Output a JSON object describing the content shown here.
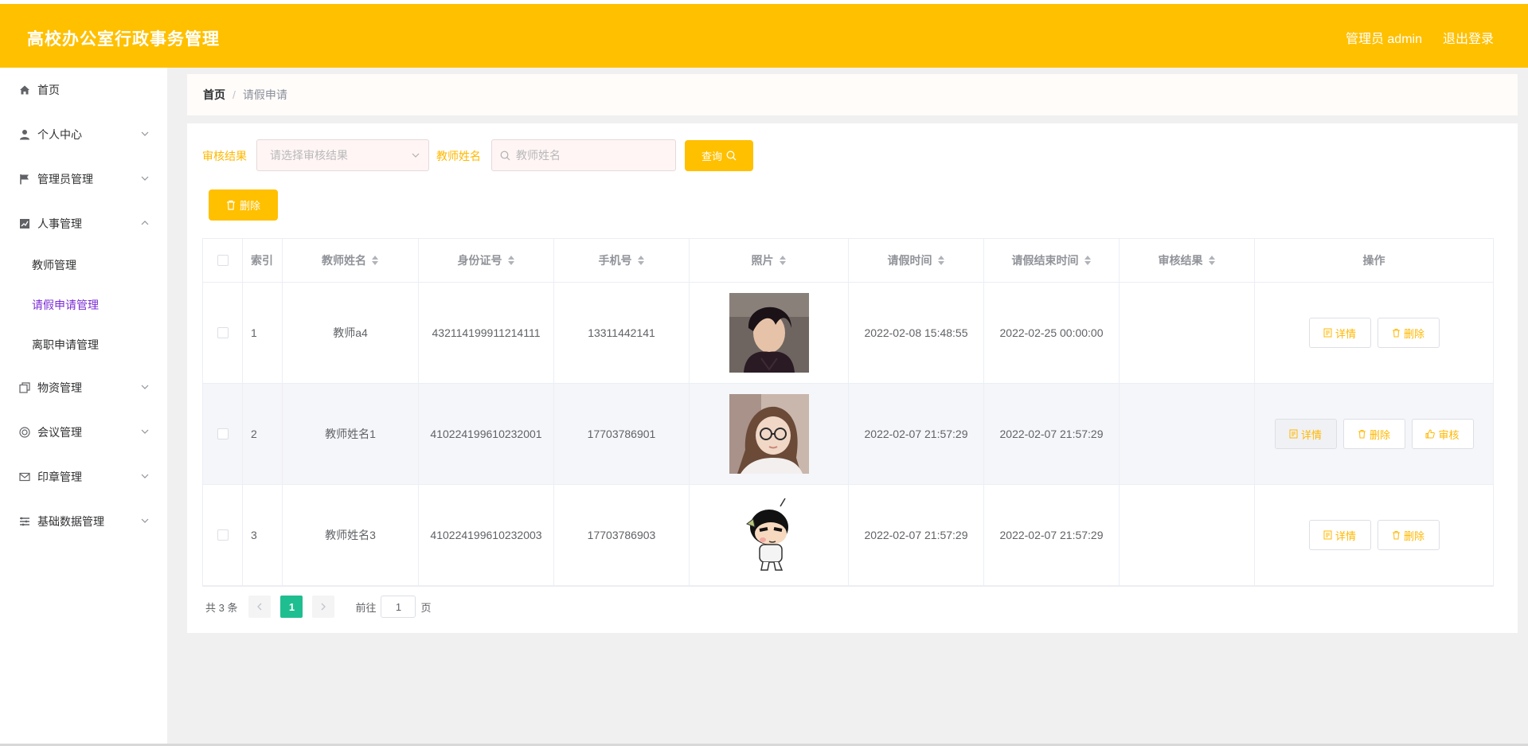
{
  "header": {
    "title": "高校办公室行政事务管理",
    "user_label": "管理员 admin",
    "logout_label": "退出登录",
    "bg_color": "#ffc000"
  },
  "sidebar": {
    "items": [
      {
        "label": "首页",
        "icon": "home-icon"
      },
      {
        "label": "个人中心",
        "icon": "user-icon"
      },
      {
        "label": "管理员管理",
        "icon": "flag-icon"
      },
      {
        "label": "人事管理",
        "icon": "chart-icon"
      },
      {
        "label": "物资管理",
        "icon": "copy-icon"
      },
      {
        "label": "会议管理",
        "icon": "target-icon"
      },
      {
        "label": "印章管理",
        "icon": "mail-icon"
      },
      {
        "label": "基础数据管理",
        "icon": "list-icon"
      }
    ],
    "subitems": [
      {
        "label": "教师管理"
      },
      {
        "label": "请假申请管理"
      },
      {
        "label": "离职申请管理"
      }
    ],
    "active_color": "#7b2cd6"
  },
  "breadcrumb": {
    "home": "首页",
    "current": "请假申请"
  },
  "search": {
    "result_label": "审核结果",
    "result_placeholder": "请选择审核结果",
    "name_label": "教师姓名",
    "name_placeholder": "教师姓名",
    "query_label": "查询",
    "delete_label": "删除"
  },
  "table": {
    "headers": [
      "索引",
      "教师姓名",
      "身份证号",
      "手机号",
      "照片",
      "请假时间",
      "请假结束时间",
      "审核结果",
      "操作"
    ],
    "rows": [
      {
        "index": "1",
        "name": "教师a4",
        "id_no": "432114199911214111",
        "phone": "13311442141",
        "start": "2022-02-08 15:48:55",
        "end": "2022-02-25 00:00:00",
        "result": "",
        "photo": "young-man-dark-hair"
      },
      {
        "index": "2",
        "name": "教师姓名1",
        "id_no": "410224199610232001",
        "phone": "17703786901",
        "start": "2022-02-07 21:57:29",
        "end": "2022-02-07 21:57:29",
        "result": "",
        "photo": "girl-with-glasses"
      },
      {
        "index": "3",
        "name": "教师姓名3",
        "id_no": "410224199610232003",
        "phone": "17703786903",
        "start": "2022-02-07 21:57:29",
        "end": "2022-02-07 21:57:29",
        "result": "",
        "photo": "cartoon-boy"
      }
    ],
    "detail_label": "详情",
    "delete_label": "删除",
    "audit_label": "审核"
  },
  "pagination": {
    "total_label": "共 3 条",
    "current_page": "1",
    "goto_label": "前往",
    "goto_value": "1",
    "page_suffix": "页",
    "active_color": "#1fbe90"
  }
}
